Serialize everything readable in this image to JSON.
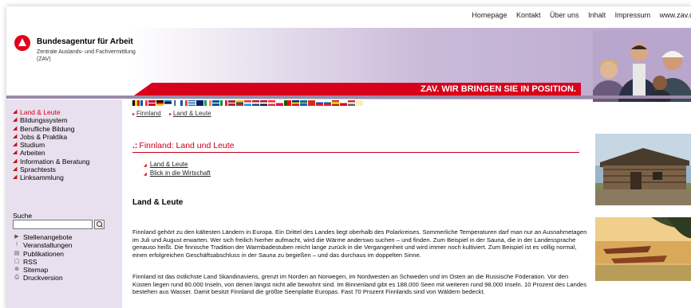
{
  "topnav": {
    "items": [
      "Homepage",
      "Kontakt",
      "Über uns",
      "Inhalt",
      "Impressum",
      "www.zav.de"
    ]
  },
  "logo": {
    "title": "Bundesagentur für Arbeit",
    "subtitle": "Zentrale Auslands- und Fachvermittlung (ZAV)"
  },
  "banner": {
    "slogan": "ZAV. WIR BRINGEN SIE IN POSITION."
  },
  "sidebar": {
    "nav": [
      {
        "label": "Land & Leute",
        "active": true
      },
      {
        "label": "Bildungssystem",
        "active": false
      },
      {
        "label": "Berufliche Bildung",
        "active": false
      },
      {
        "label": "Jobs & Praktika",
        "active": false
      },
      {
        "label": "Studium",
        "active": false
      },
      {
        "label": "Arbeiten",
        "active": false
      },
      {
        "label": "Information & Beratung",
        "active": false
      },
      {
        "label": "Sprachtests",
        "active": false
      },
      {
        "label": "Linksammlung",
        "active": false
      }
    ],
    "search_label": "Suche",
    "search_value": "",
    "tools": [
      {
        "icon": "arrow-icon",
        "label": "Stellenangebote"
      },
      {
        "icon": "exclamation-icon",
        "label": "Veranstaltungen"
      },
      {
        "icon": "document-icon",
        "label": "Publikationen"
      },
      {
        "icon": "rss-icon",
        "label": "RSS"
      },
      {
        "icon": "sitemap-icon",
        "label": "Sitemap"
      },
      {
        "icon": "print-icon",
        "label": "Druckversion"
      }
    ]
  },
  "breadcrumb": [
    "Finnland",
    "Land & Leute"
  ],
  "main": {
    "heading": "Finnland: Land und Leute",
    "sublinks": [
      "Land & Leute",
      "Blick in die Wirtschaft"
    ],
    "section_title": "Land & Leute",
    "paragraph1": "Finnland gehört zu den kältesten Ländern in Europa. Ein Drittel des Landes liegt oberhalb des Polarkreises. Sommerliche Temperaturen darf man nur an Ausnahmetagen im Juli und August erwarten. Wer sich freilich hierher aufmacht, wird die Wärme anderswo suchen – und finden. Zum Beispiel in der Sauna, die in der Landessprache genauso heißt. Die finnische Tradition der Warmbadestuben reicht lange zurück in die Vergangenheit und wird immer noch kultiviert. Zum Beispiel ist es völlig normal, einen erfolgreichen Geschäftsabschluss in der Sauna zu begießen – und das durchaus im doppelten Sinne.",
    "paragraph2": "Finnland ist das östlichste Land Skandinaviens, grenzt im Norden an Norwegen, im Nordwesten an Schweden und im Osten an die Russische Föderation. Vor den Küsten liegen rund 80.000 Inseln, von denen längst nicht alle bewohnt sind. Im Binnenland gibt es 188.000 Seen mit weiteren rund 98.000 Inseln. 10 Prozent des Landes bestehen aus Wasser. Damit besitzt Finnland die größte Seenplatte Europas. Fast 70 Prozent Finnlands sind von Wäldern bedeckt."
  },
  "colors": {
    "accent": "#d9001b",
    "sidebar_bg": "#e8e0ee",
    "header_purple": "#b9a6cc"
  }
}
